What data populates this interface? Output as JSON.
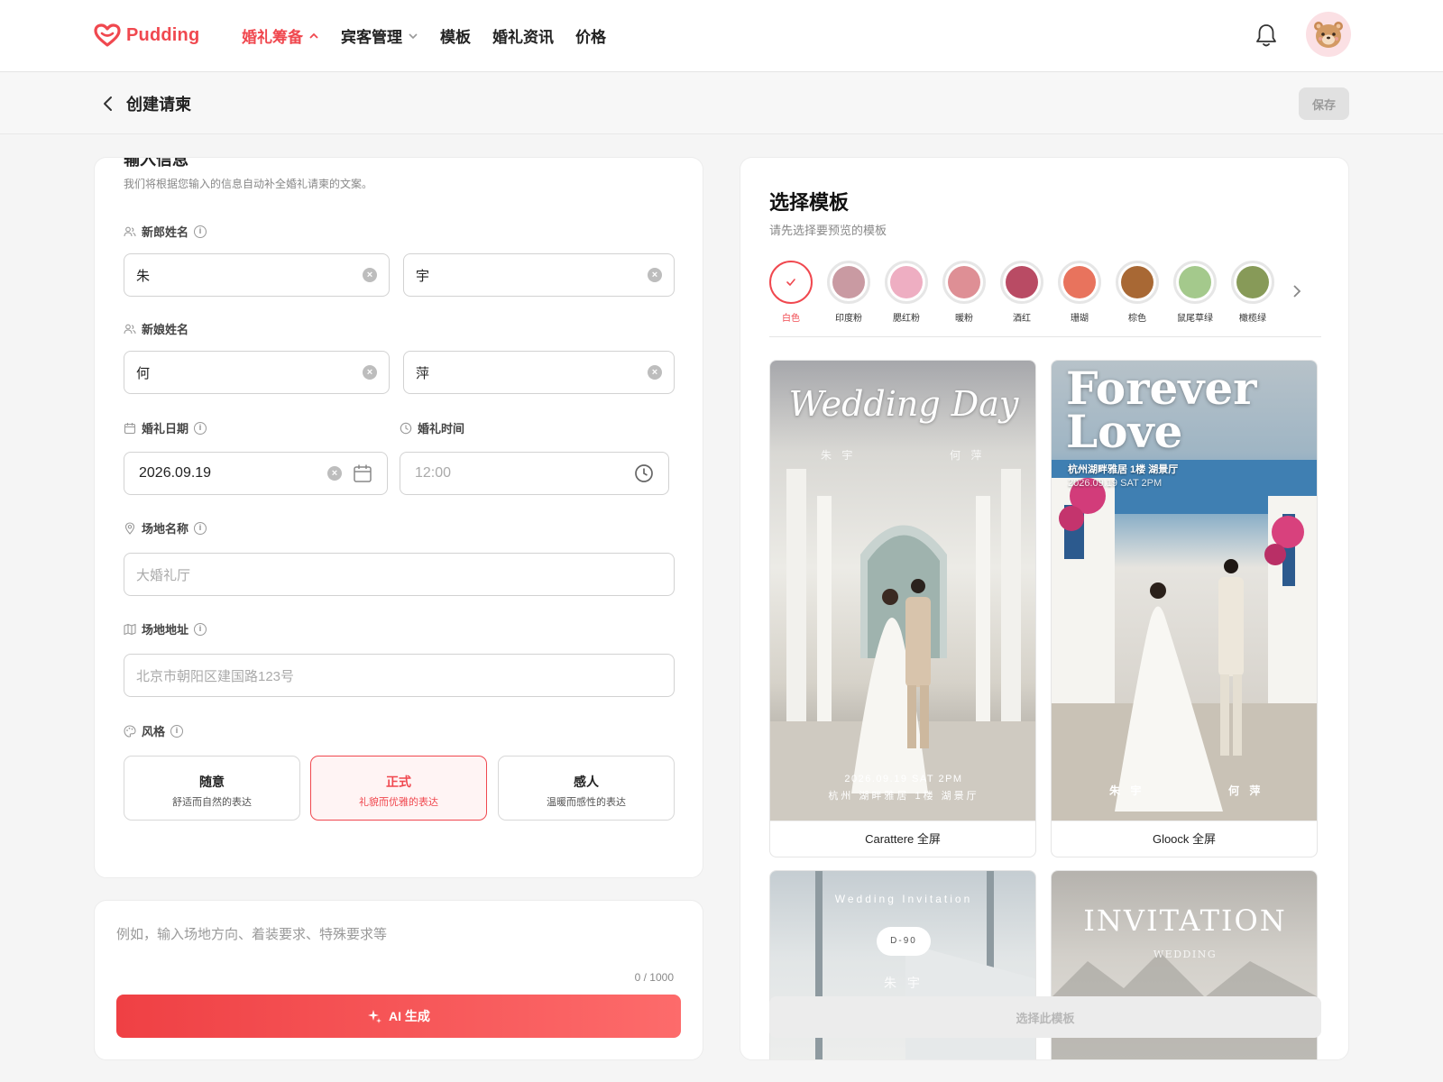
{
  "brand": {
    "name": "Pudding",
    "accent": "#f0484f"
  },
  "nav": {
    "items": [
      {
        "label": "婚礼筹备",
        "active": true
      },
      {
        "label": "宾客管理"
      },
      {
        "label": "模板"
      },
      {
        "label": "婚礼资讯"
      },
      {
        "label": "价格"
      }
    ]
  },
  "header": {
    "title": "创建请柬",
    "save_label": "保存"
  },
  "form": {
    "heading": "输入信息",
    "description": "我们将根据您输入的信息自动补全婚礼请柬的文案。",
    "groom": {
      "label": "新郎姓名",
      "last": "朱",
      "first": "宇"
    },
    "bride": {
      "label": "新娘姓名",
      "last": "何",
      "first": "萍"
    },
    "date": {
      "label": "婚礼日期",
      "value": "2026.09.19"
    },
    "time": {
      "label": "婚礼时间",
      "placeholder": "12:00"
    },
    "venue": {
      "label": "场地名称",
      "placeholder": "大婚礼厅"
    },
    "address": {
      "label": "场地地址",
      "placeholder": "北京市朝阳区建国路123号"
    },
    "style": {
      "label": "风格",
      "options": [
        {
          "title": "随意",
          "desc": "舒适而自然的表达"
        },
        {
          "title": "正式",
          "desc": "礼貌而优雅的表达",
          "selected": true
        },
        {
          "title": "感人",
          "desc": "温暖而感性的表达"
        }
      ]
    }
  },
  "prompt": {
    "placeholder": "例如，输入场地方向、着装要求、特殊要求等",
    "counter": "0 / 1000",
    "ai_button": "AI 生成"
  },
  "templates": {
    "title": "选择模板",
    "subtitle": "请先选择要预览的模板",
    "colors": [
      {
        "name": "白色",
        "hex": "#ffffff",
        "selected": true
      },
      {
        "name": "印度粉",
        "hex": "#c99aa2"
      },
      {
        "name": "腮红粉",
        "hex": "#eeaec2"
      },
      {
        "name": "暖粉",
        "hex": "#de8f95"
      },
      {
        "name": "酒红",
        "hex": "#b94b64"
      },
      {
        "name": "珊瑚",
        "hex": "#e8735d"
      },
      {
        "name": "棕色",
        "hex": "#a86834"
      },
      {
        "name": "鼠尾草绿",
        "hex": "#a4c98c"
      },
      {
        "name": "橄榄绿",
        "hex": "#879a58"
      }
    ],
    "items": [
      {
        "name": "Carattere 全屏",
        "headline": "Wedding Day",
        "groom": "朱 宇",
        "bride": "何 萍",
        "datetime": "2026.09.19 SAT 2PM",
        "venue": "杭州 湖畔雅居 1楼 湖景厅"
      },
      {
        "name": "Gloock 全屏",
        "headline1": "Forever",
        "headline2": "Love",
        "venue": "杭州湖畔雅居 1楼 湖景厅",
        "datetime": "2026.09.19 SAT 2PM",
        "groom": "朱 宇",
        "bride": "何 萍"
      },
      {
        "headline": "Wedding Invitation",
        "badge": "D-90",
        "groom": "朱 宇"
      },
      {
        "headline": "INVITATION",
        "sub": "WEDDING"
      }
    ],
    "choose_label": "选择此模板"
  }
}
